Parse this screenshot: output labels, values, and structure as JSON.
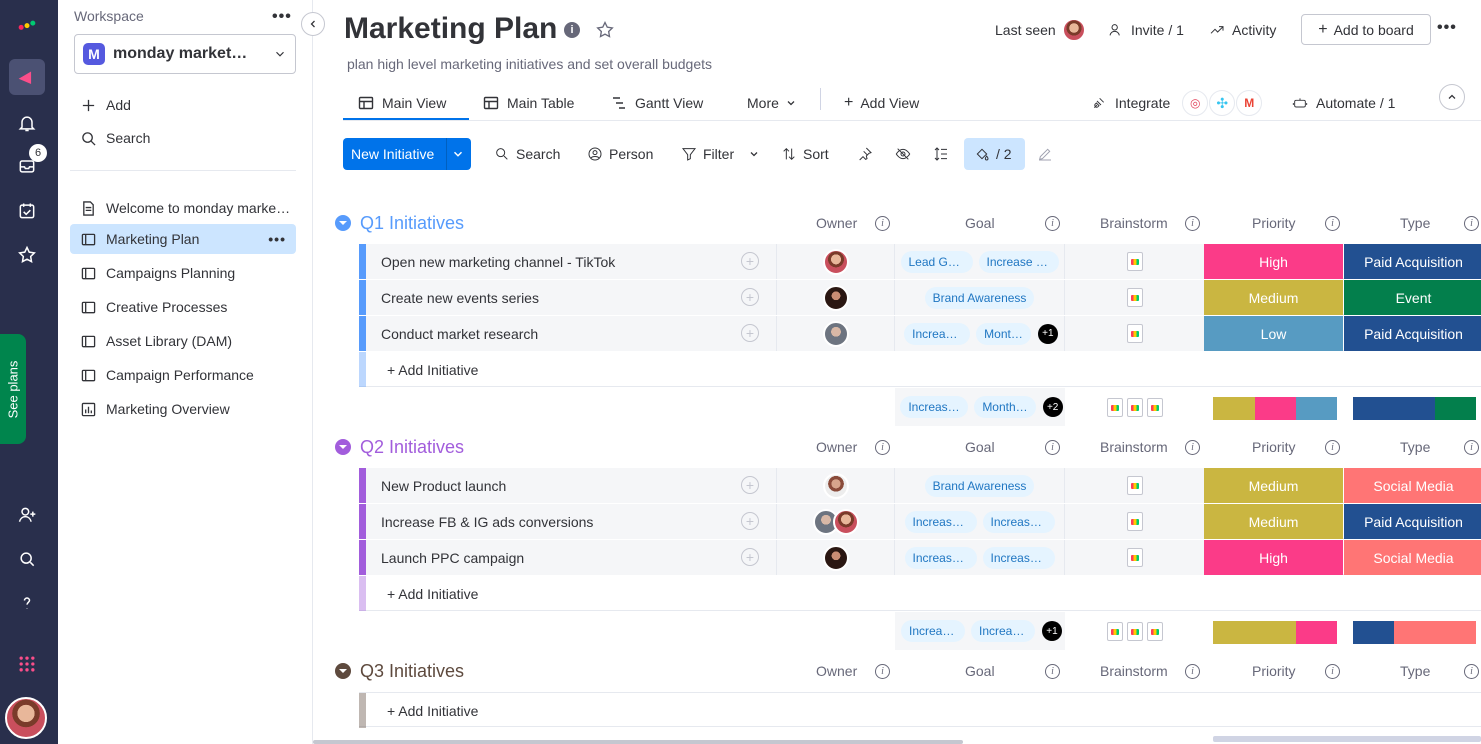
{
  "colors": {
    "accent": "#0073ea",
    "q1": "#579bfc",
    "q2": "#a25ddc",
    "q3": "#5e4a3e",
    "high": "#fb3b88",
    "medium": "#cab641",
    "low": "#579bc2",
    "paid": "#225091",
    "event": "#037f4c",
    "social": "#ff7575"
  },
  "rail": {
    "inbox_badge": "6",
    "see_plans": "See plans"
  },
  "sidebar": {
    "workspace_label": "Workspace",
    "workspace_name": "monday market…",
    "workspace_initial": "M",
    "add": "Add",
    "search": "Search",
    "items": [
      {
        "label": "Welcome to monday marke…",
        "icon": "doc-icon"
      },
      {
        "label": "Marketing Plan",
        "icon": "board-icon"
      },
      {
        "label": "Campaigns Planning",
        "icon": "board-icon"
      },
      {
        "label": "Creative Processes",
        "icon": "board-icon"
      },
      {
        "label": "Asset Library (DAM)",
        "icon": "board-icon"
      },
      {
        "label": "Campaign Performance",
        "icon": "board-icon"
      },
      {
        "label": "Marketing Overview",
        "icon": "dashboard-icon"
      }
    ]
  },
  "header": {
    "title": "Marketing Plan",
    "subtitle": "plan high level marketing initiatives and set overall budgets",
    "last_seen": "Last seen",
    "invite": "Invite / 1",
    "activity": "Activity",
    "add_to_board": "Add to board"
  },
  "tabs": {
    "main_view": "Main View",
    "main_table": "Main Table",
    "gantt": "Gantt View",
    "more": "More",
    "add_view": "Add View",
    "integrate": "Integrate",
    "automate": "Automate / 1"
  },
  "toolbar": {
    "new_item": "New Initiative",
    "search": "Search",
    "person": "Person",
    "filter": "Filter",
    "sort": "Sort",
    "color_count": "/ 2"
  },
  "columns": {
    "owner": "Owner",
    "goal": "Goal",
    "brainstorm": "Brainstorm",
    "priority": "Priority",
    "type": "Type"
  },
  "add_item": "+ Add Initiative",
  "groups": [
    {
      "title": "Q1 Initiatives",
      "rows": [
        {
          "name": "Open new marketing channel - TikTok",
          "goals": [
            "Lead Ge…",
            "Increase C…"
          ],
          "priority": "High",
          "type": "Paid Acquisition"
        },
        {
          "name": "Create new events series",
          "goals": [
            "Brand Awareness"
          ],
          "priority": "Medium",
          "type": "Event"
        },
        {
          "name": "Conduct market research",
          "goals": [
            "Increase …",
            "Mont…"
          ],
          "goal_more": "+1",
          "priority": "Low",
          "type": "Paid Acquisition"
        }
      ],
      "summary": {
        "goals": [
          "Increase …",
          "Month…"
        ],
        "goal_more": "+2"
      }
    },
    {
      "title": "Q2 Initiatives",
      "rows": [
        {
          "name": "New Product launch",
          "goals": [
            "Brand Awareness"
          ],
          "priority": "Medium",
          "type": "Social Media"
        },
        {
          "name": "Increase FB & IG ads conversions",
          "goals": [
            "Increase …",
            "Increase …"
          ],
          "priority": "Medium",
          "type": "Paid Acquisition"
        },
        {
          "name": "Launch PPC campaign",
          "goals": [
            "Increase …",
            "Increase …"
          ],
          "priority": "High",
          "type": "Social Media"
        }
      ],
      "summary": {
        "goals": [
          "Increas…",
          "Increas…"
        ],
        "goal_more": "+1"
      }
    },
    {
      "title": "Q3 Initiatives",
      "rows": []
    }
  ]
}
